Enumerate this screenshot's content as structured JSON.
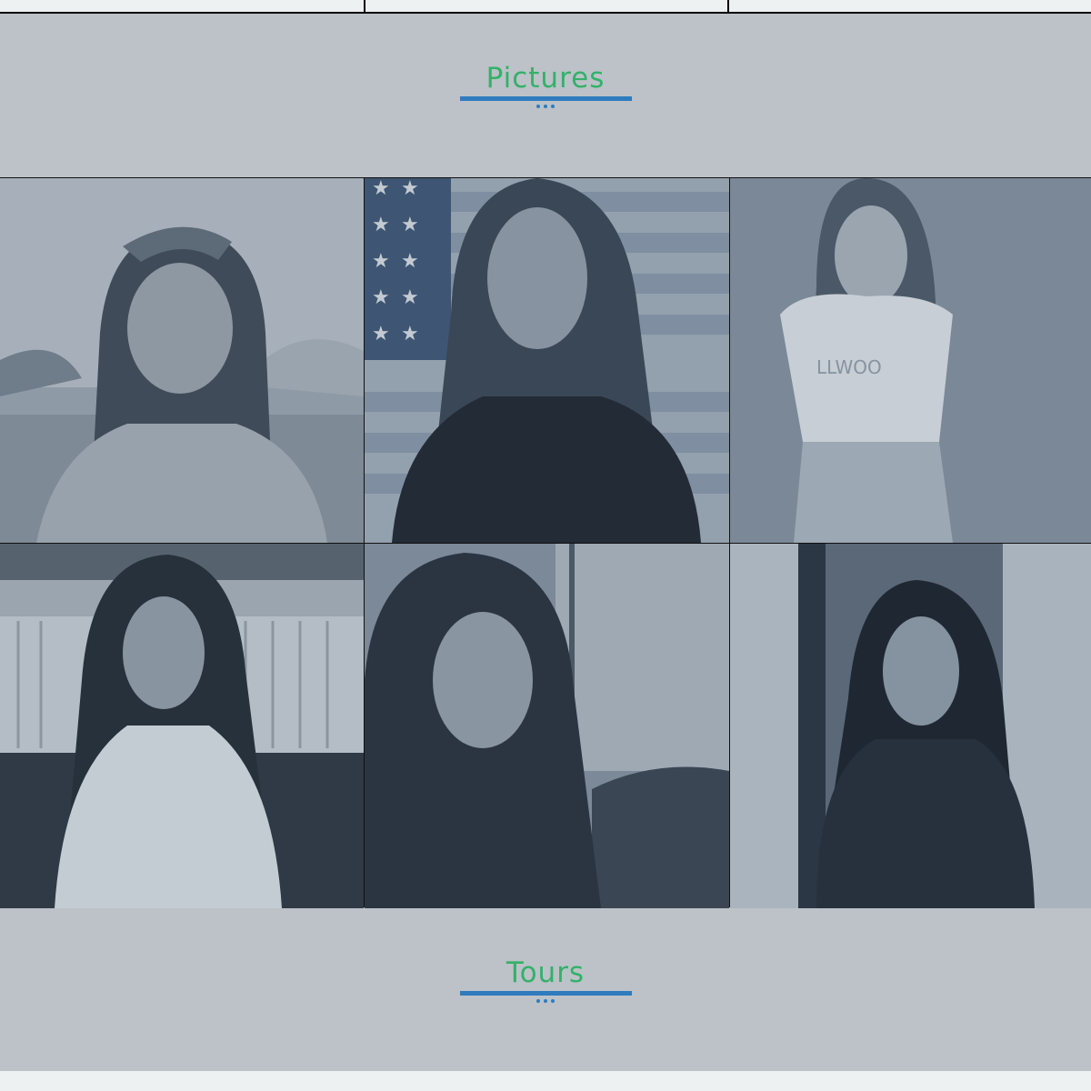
{
  "sections": {
    "pictures": {
      "title": "Pictures"
    },
    "tours": {
      "title": "Tours"
    }
  },
  "gallery": {
    "photos": [
      {
        "name": "photo-1",
        "scene": "woman-with-headscarf-in-field"
      },
      {
        "name": "photo-2",
        "scene": "woman-in-front-of-american-flag"
      },
      {
        "name": "photo-3",
        "scene": "woman-in-hollywood-tshirt"
      },
      {
        "name": "photo-4",
        "scene": "woman-in-front-of-radiator"
      },
      {
        "name": "photo-5",
        "scene": "woman-reclining-on-sofa"
      },
      {
        "name": "photo-6",
        "scene": "woman-in-doorway-leather-jacket"
      }
    ]
  },
  "colors": {
    "background": "#bcc2c7",
    "title": "#33b16a",
    "accent": "#2f7bbe",
    "photo_tint": "#3d5a7a"
  }
}
